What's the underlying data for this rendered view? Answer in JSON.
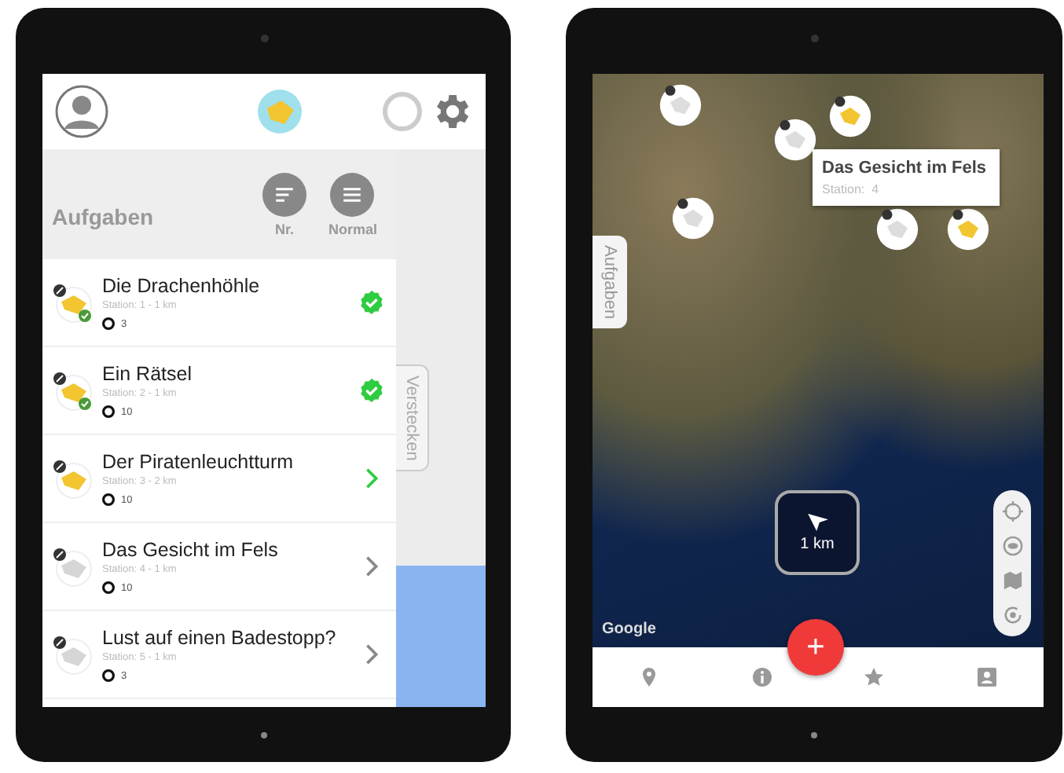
{
  "task_screen": {
    "title": "Aufgaben",
    "sort_buttons": [
      {
        "label": "Nr.",
        "kind": "sort"
      },
      {
        "label": "Normal",
        "kind": "list"
      }
    ],
    "tasks": [
      {
        "title": "Die Drachenhöhle",
        "station": "Station: 1 - 1 km",
        "points": "3",
        "completed": true,
        "unlocked": true
      },
      {
        "title": "Ein Rätsel",
        "station": "Station: 2 - 1 km",
        "points": "10",
        "completed": true,
        "unlocked": true
      },
      {
        "title": "Der Piratenleuchtturm",
        "station": "Station: 3 - 2 km",
        "points": "10",
        "completed": false,
        "unlocked": true
      },
      {
        "title": "Das Gesicht im Fels",
        "station": "Station: 4 - 1 km",
        "points": "10",
        "completed": false,
        "unlocked": false
      },
      {
        "title": "Lust auf einen Badestopp?",
        "station": "Station: 5 - 1 km",
        "points": "3",
        "completed": false,
        "unlocked": false
      }
    ],
    "hide_tab": "Verstecken"
  },
  "map_screen": {
    "popup": {
      "title": "Das Gesicht im Fels",
      "subtitle": "Station:  4"
    },
    "side_tab": "Aufgaben",
    "scale": "1 km",
    "attribution": "Google",
    "fab": "+"
  }
}
